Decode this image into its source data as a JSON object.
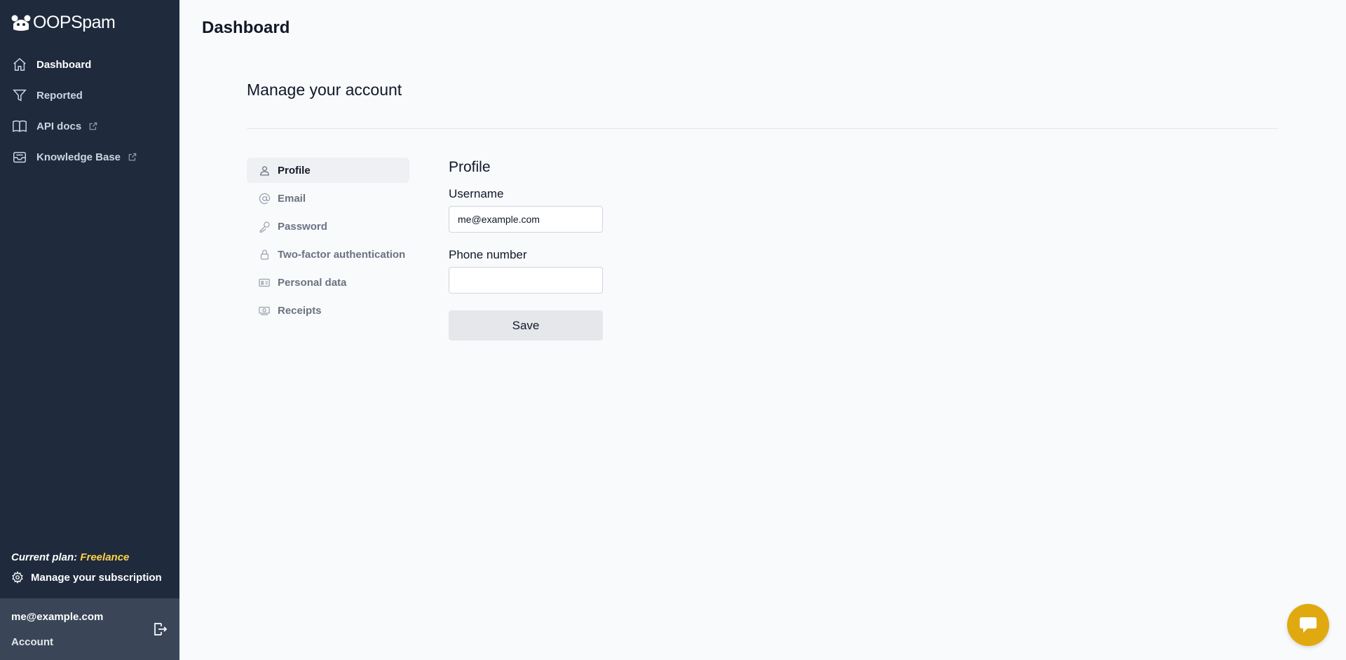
{
  "app": {
    "logo_text": "OOPSpam"
  },
  "sidebar": {
    "items": [
      {
        "label": "Dashboard",
        "icon": "home-icon",
        "external": false
      },
      {
        "label": "Reported",
        "icon": "filter-icon",
        "external": false
      },
      {
        "label": "API docs",
        "icon": "book-icon",
        "external": true
      },
      {
        "label": "Knowledge Base",
        "icon": "inbox-icon",
        "external": true
      }
    ],
    "plan_prefix": "Current plan:",
    "plan_name": "Freelance",
    "manage_subscription": "Manage your subscription",
    "account_email": "me@example.com",
    "account_label": "Account"
  },
  "main": {
    "page_title": "Dashboard",
    "section_title": "Manage your account",
    "subnav": [
      {
        "label": "Profile",
        "icon": "user-icon"
      },
      {
        "label": "Email",
        "icon": "at-sign-icon"
      },
      {
        "label": "Password",
        "icon": "key-icon"
      },
      {
        "label": "Two-factor authentication",
        "icon": "lock-icon"
      },
      {
        "label": "Personal data",
        "icon": "id-card-icon"
      },
      {
        "label": "Receipts",
        "icon": "money-icon"
      }
    ],
    "form": {
      "title": "Profile",
      "username_label": "Username",
      "username_value": "me@example.com",
      "phone_label": "Phone number",
      "phone_value": "",
      "save_label": "Save"
    }
  },
  "colors": {
    "sidebar_bg": "#1f2a3c",
    "plan_accent": "#fcd34d",
    "chat_button": "#e0a910"
  }
}
